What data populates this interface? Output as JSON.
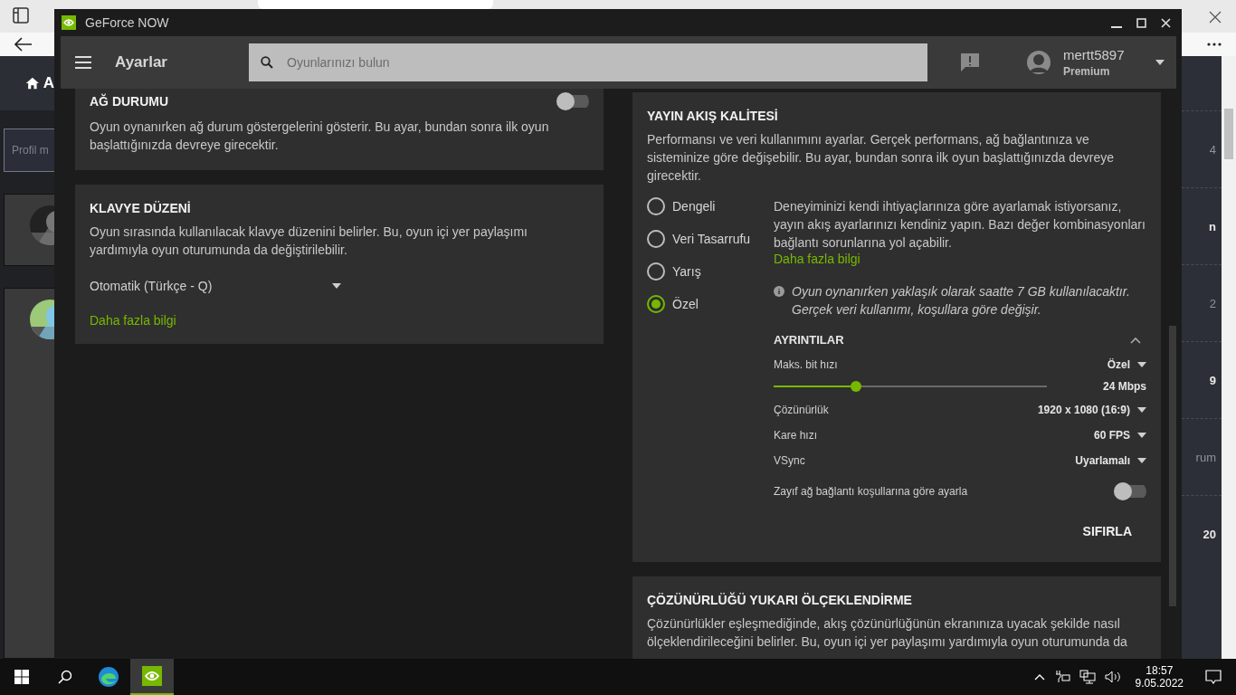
{
  "browser": {
    "page_header_letter": "A",
    "profile_field": {
      "placeholder": "Profil m"
    },
    "right_fragments": [
      "4",
      "n",
      "2",
      "9",
      "rum",
      "20"
    ]
  },
  "window": {
    "title": "GeForce NOW"
  },
  "header": {
    "title": "Ayarlar",
    "search": {
      "placeholder": "Oyunlarınızı bulun"
    },
    "user": {
      "name": "mertt5897",
      "tier": "Premium"
    }
  },
  "left_cards": [
    {
      "title": "AĞ DURUMU",
      "description": "Oyun oynanırken ağ durum göstergelerini gösterir. Bu ayar, bundan sonra ilk oyun başlattığınızda devreye girecektir.",
      "toggle": {
        "on": false
      }
    },
    {
      "title": "KLAVYE DÜZENİ",
      "description": "Oyun sırasında kullanılacak klavye düzenini belirler. Bu, oyun içi yer paylaşımı yardımıyla oyun oturumunda da değiştirilebilir.",
      "dropdown": "Otomatik (Türkçe - Q)",
      "link": "Daha fazla bilgi"
    }
  ],
  "quality": {
    "title": "YAYIN AKIŞ KALİTESİ",
    "description": "Performansı ve veri kullanımını ayarlar. Gerçek performans, ağ bağlantınıza ve sisteminize göre değişebilir. Bu ayar, bundan sonra ilk oyun başlattığınızda devreye girecektir.",
    "options": [
      {
        "label": "Dengeli",
        "selected": false
      },
      {
        "label": "Veri Tasarrufu",
        "selected": false
      },
      {
        "label": "Yarış",
        "selected": false
      },
      {
        "label": "Özel",
        "selected": true
      }
    ],
    "custom_text": "Deneyiminizi kendi ihtiyaçlarınıza göre ayarlamak istiyorsanız, yayın akış ayarlarınızı kendiniz yapın. Bazı değer kombinasyonları bağlantı sorunlarına yol açabilir.",
    "link": "Daha fazla bilgi",
    "note": "Oyun oynanırken yaklaşık olarak saatte 7 GB kullanılacaktır. Gerçek veri kullanımı, koşullara göre değişir.",
    "details": {
      "title": "AYRINTILAR",
      "expanded": true,
      "bitrate": {
        "label": "Maks. bit hızı",
        "value": "Özel",
        "level": 0.3,
        "reading": "24 Mbps"
      },
      "rows": [
        {
          "label": "Çözünürlük",
          "value": "1920 x 1080 (16:9)"
        },
        {
          "label": "Kare hızı",
          "value": "60 FPS"
        },
        {
          "label": "VSync",
          "value": "Uyarlamalı"
        }
      ],
      "adaptive": {
        "label": "Zayıf ağ bağlantı koşullarına göre ayarla",
        "on": false
      }
    },
    "reset": "SIFIRLA"
  },
  "upscaling": {
    "title": "ÇÖZÜNÜRLÜĞÜ YUKARI ÖLÇEKLENDİRME",
    "description": "Çözünürlükler eşleşmediğinde, akış çözünürlüğünün ekranınıza uyacak şekilde nasıl ölçeklendirileceğini belirler. Bu, oyun içi yer paylaşımı yardımıyla oyun oturumunda da"
  },
  "taskbar": {
    "time": "18:57",
    "date": "9.05.2022"
  }
}
